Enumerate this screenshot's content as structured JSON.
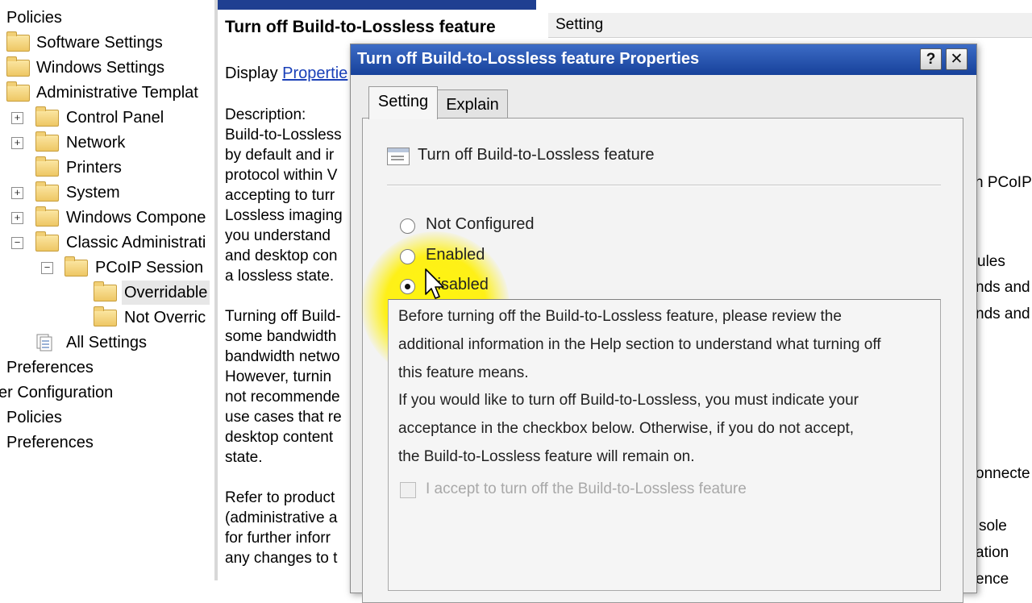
{
  "tree": {
    "items": [
      {
        "label": "Policies"
      },
      {
        "label": "Software Settings"
      },
      {
        "label": "Windows Settings"
      },
      {
        "label": "Administrative Templat"
      },
      {
        "label": "Control Panel"
      },
      {
        "label": "Network"
      },
      {
        "label": "Printers"
      },
      {
        "label": "System"
      },
      {
        "label": "Windows Compone"
      },
      {
        "label": "Classic Administrati"
      },
      {
        "label": "PCoIP Session"
      },
      {
        "label": "Overridable"
      },
      {
        "label": "Not Overric"
      },
      {
        "label": "All Settings"
      },
      {
        "label": "Preferences"
      },
      {
        "label": "er Configuration"
      },
      {
        "label": "Policies"
      },
      {
        "label": "Preferences"
      }
    ]
  },
  "middle": {
    "title": "Turn off Build-to-Lossless feature",
    "display_prefix": "Display",
    "display_link": "Propertie",
    "description_lines": [
      "Description:",
      "Build-to-Lossless",
      "by default and ir",
      "protocol within V",
      "accepting to turr",
      "Lossless imaging",
      "you understand",
      "and desktop con",
      "a lossless state.",
      "",
      "Turning off Build-",
      "some bandwidth",
      "bandwidth netwo",
      "However, turnin",
      "not recommende",
      "use cases that re",
      "desktop content",
      "state.",
      "",
      "Refer to product",
      "(administrative a",
      "for further inforr",
      "any changes to t"
    ]
  },
  "right": {
    "column_header": "Setting",
    "fragments": [
      "n PCoIP",
      "ules",
      "nds and",
      "nds and",
      "onnecte",
      "sole",
      "ation",
      "ence"
    ]
  },
  "dialog": {
    "title": "Turn off Build-to-Lossless feature Properties",
    "help_label": "?",
    "close_label": "✕",
    "tabs": [
      {
        "label": "Setting"
      },
      {
        "label": "Explain"
      }
    ],
    "policy_name": "Turn off Build-to-Lossless feature",
    "options": [
      {
        "label": "Not Configured",
        "checked": false
      },
      {
        "label": "Enabled",
        "checked": false
      },
      {
        "label": "Disabled",
        "checked": true
      }
    ],
    "info_lines": [
      "Before turning off the Build-to-Lossless feature, please review the",
      "additional information in the Help section to understand what turning off",
      "this feature means.",
      "If you would like to turn off Build-to-Lossless, you must indicate your",
      "acceptance in the checkbox below.  Otherwise, if you do not accept,",
      "the Build-to-Lossless feature will remain on."
    ],
    "accept_label": "I accept to turn off the Build-to-Lossless feature",
    "accept_checked": false
  },
  "colors": {
    "titlebar": "#17419a",
    "highlight": "#fff000",
    "link": "#1a40b8"
  }
}
